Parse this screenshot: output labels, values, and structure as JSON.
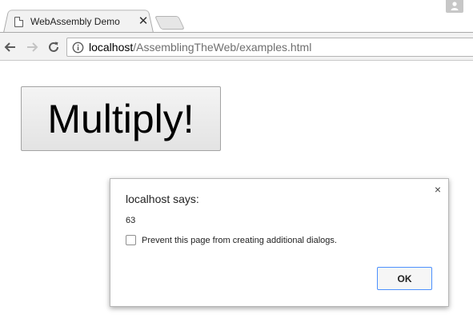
{
  "browser": {
    "tab": {
      "title": "WebAssembly Demo",
      "close_glyph": "✕"
    },
    "omnibox": {
      "url_host": "localhost",
      "url_path": "/AssemblingTheWeb/examples.html"
    },
    "icons": {
      "back": "arrow-left-icon",
      "forward": "arrow-right-icon",
      "reload": "reload-icon",
      "info": "info-icon",
      "page": "page-icon",
      "profile": "person-icon"
    }
  },
  "page": {
    "multiply_button_label": "Multiply!"
  },
  "dialog": {
    "title": "localhost says:",
    "message": "63",
    "checkbox_label": "Prevent this page from creating additional dialogs.",
    "checkbox_checked": false,
    "ok_label": "OK",
    "close_glyph": "×"
  },
  "colors": {
    "toolbar_bg": "#f2f2f2",
    "ok_border": "#4d90fe",
    "url_path": "#6f6f6f"
  }
}
